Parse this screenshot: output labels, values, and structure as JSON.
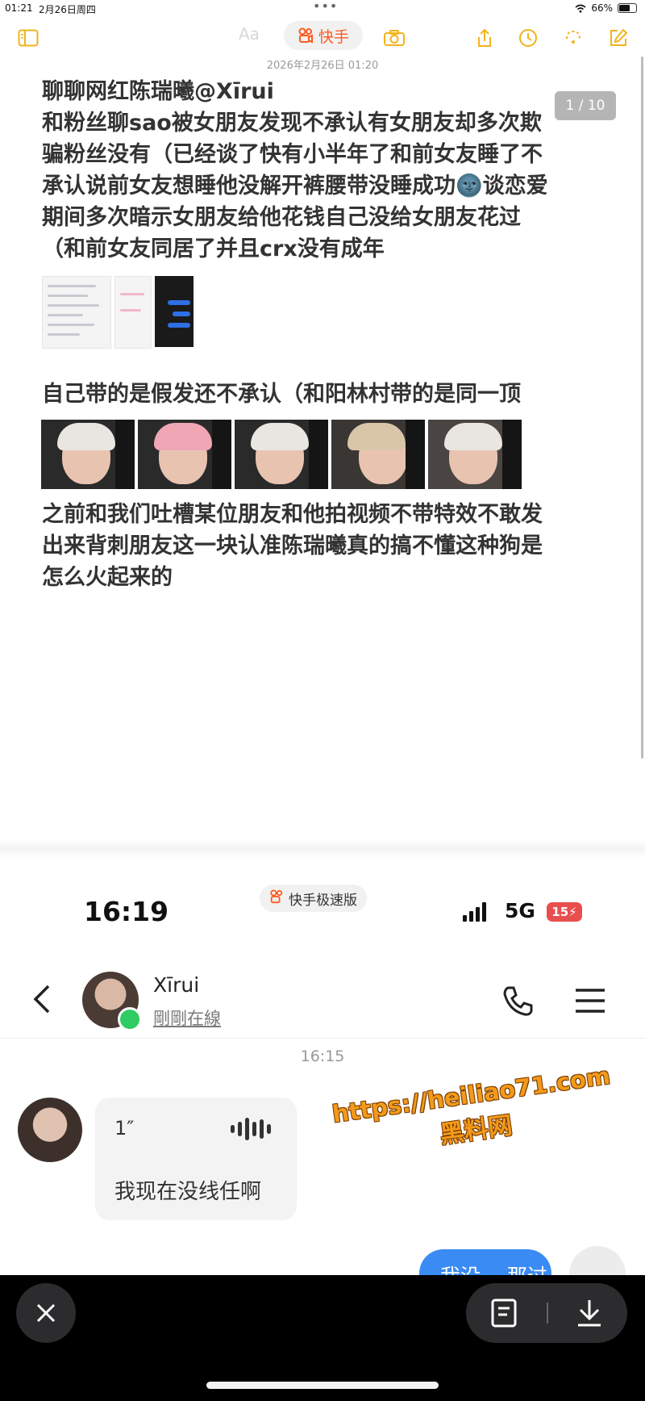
{
  "status_bar": {
    "time": "01:21",
    "date": "2月26日周四",
    "more": "•••",
    "battery_pct": "66%",
    "battery_level": 0.66
  },
  "toolbar": {
    "format_label": "Aa",
    "app_label": "快手",
    "colors": {
      "accent": "#f2b31b",
      "kuaishou": "#ff5a1f"
    }
  },
  "note": {
    "date": "2026年2月26日 01:20",
    "page_indicator": "1 / 10",
    "title_line": "聊聊网红陈瑞曦@Xīrui",
    "para1_lines": [
      "和粉丝聊sao被女朋友发现不承认有女朋友却多次欺",
      "骗粉丝没有（已经谈了快有小半年了和前女友睡了不",
      "承认说前女友想睡他没解开裤腰带没睡成功🌚谈恋爱",
      "期间多次暗示女朋友给他花钱自己没给女朋友花过",
      "（和前女友同居了并且crx没有成年"
    ],
    "para2": "自己带的是假发还不承认（和阳林村带的是同一顶",
    "para3_lines": [
      "之前和我们吐槽某位朋友和他拍视频不带特效不敢发",
      "出来背刺朋友这一块认准陈瑞曦真的搞不懂这种狗是",
      "怎么火起来的"
    ]
  },
  "phone_shot": {
    "time": "16:19",
    "app_pill": "快手极速版",
    "network": "5G",
    "battery": "15",
    "contact_name": "Xīrui",
    "contact_status": "剛剛在線",
    "message_time": "16:15",
    "voice_duration": "1″",
    "received_text": "我现在没线任啊",
    "sent_text": "我没… 那过",
    "watermark_line1": "https://heiliao71.com",
    "watermark_line2": "黑料网"
  }
}
